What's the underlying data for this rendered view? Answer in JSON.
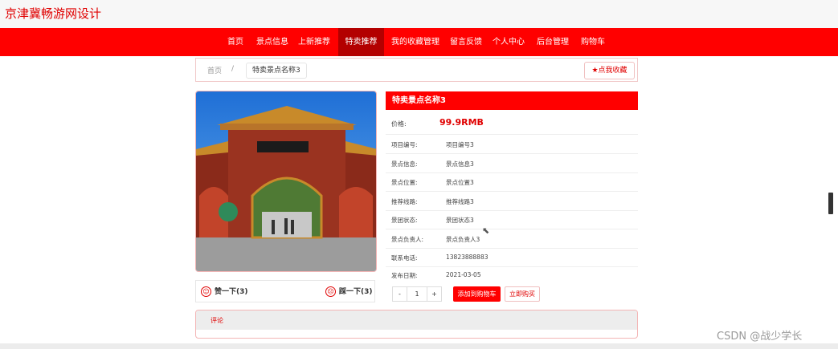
{
  "site": {
    "title": "京津冀畅游网设计"
  },
  "nav": {
    "items": [
      {
        "label": "首页"
      },
      {
        "label": "景点信息"
      },
      {
        "label": "上新推荐"
      },
      {
        "label": "特卖推荐"
      },
      {
        "label": "我的收藏管理"
      },
      {
        "label": "留言反馈"
      },
      {
        "label": "个人中心"
      },
      {
        "label": "后台管理"
      },
      {
        "label": "购物车"
      }
    ],
    "active_index": 3
  },
  "breadcrumb": {
    "home": "首页",
    "separator": "/",
    "current": "特卖景点名称3"
  },
  "favorite_button": {
    "icon": "star-icon",
    "label": "点我收藏"
  },
  "votes": {
    "like_icon": "smile-icon",
    "like_label": "赞一下(3)",
    "dislike_icon": "frown-icon",
    "dislike_label": "踩一下(3)"
  },
  "detail": {
    "title": "特卖景点名称3",
    "price_label": "价格:",
    "price_value": "99.9RMB",
    "fields": [
      {
        "label": "项目编号:",
        "value": "项目编号3"
      },
      {
        "label": "景点信息:",
        "value": "景点信息3"
      },
      {
        "label": "景点位置:",
        "value": "景点位置3"
      },
      {
        "label": "推荐线路:",
        "value": "推荐线路3"
      },
      {
        "label": "景团状态:",
        "value": "景团状态3"
      },
      {
        "label": "景点负责人:",
        "value": "景点负责人3"
      },
      {
        "label": "联系电话:",
        "value": "13823888883"
      },
      {
        "label": "发布日期:",
        "value": "2021-03-05"
      }
    ]
  },
  "purchase": {
    "minus": "-",
    "quantity": "1",
    "plus": "+",
    "add_to_cart": "添加到购物车",
    "buy_now": "立即购买"
  },
  "comments": {
    "label": "评论"
  },
  "watermark": "CSDN @战少学长",
  "colors": {
    "brand": "#ff0000",
    "nav_active": "#b30000",
    "text": "#333333"
  }
}
